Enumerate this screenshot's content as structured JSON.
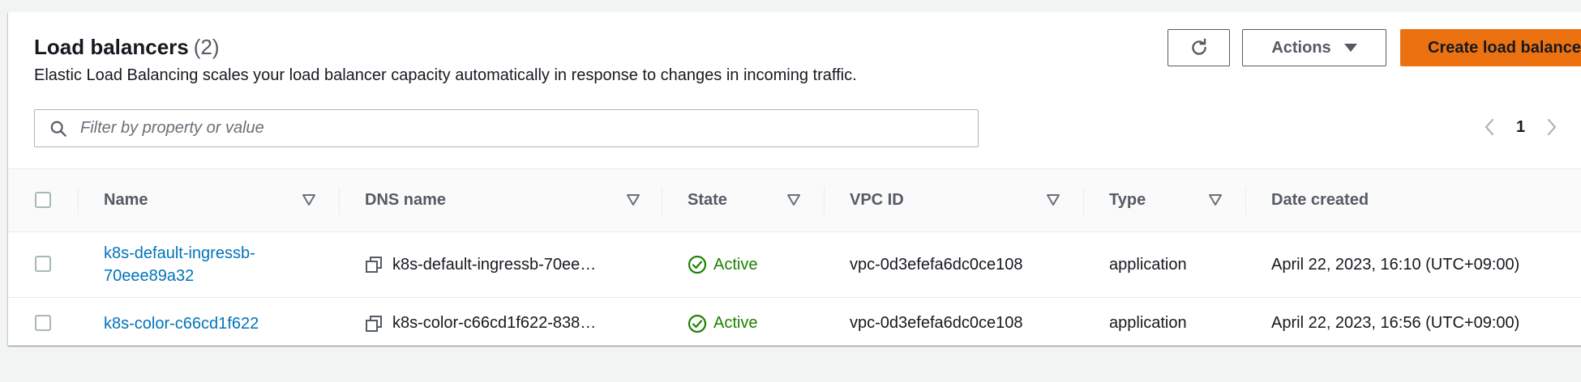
{
  "header": {
    "title": "Load balancers",
    "count": "(2)",
    "subtitle": "Elastic Load Balancing scales your load balancer capacity automatically in response to changes in incoming traffic."
  },
  "toolbar": {
    "refresh_icon": "refresh-icon",
    "actions_label": "Actions",
    "create_label": "Create load balancer"
  },
  "search": {
    "placeholder": "Filter by property or value",
    "value": ""
  },
  "pagination": {
    "current_page": "1"
  },
  "table": {
    "columns": [
      "Name",
      "DNS name",
      "State",
      "VPC ID",
      "Type",
      "Date created"
    ],
    "rows": [
      {
        "name": "k8s-default-ingressb-70eee89a32",
        "name_line1": "k8s-default-ingressb-",
        "name_line2": "70eee89a32",
        "dns": "k8s-default-ingressb-70ee…",
        "state": "Active",
        "vpc": "vpc-0d3efefa6dc0ce108",
        "type": "application",
        "date": "April 22, 2023, 16:10 (UTC+09:00)"
      },
      {
        "name": "k8s-color-c66cd1f622",
        "dns": "k8s-color-c66cd1f622-838…",
        "state": "Active",
        "vpc": "vpc-0d3efefa6dc0ce108",
        "type": "application",
        "date": "April 22, 2023, 16:56 (UTC+09:00)"
      }
    ]
  },
  "colors": {
    "primary": "#ec7211",
    "link": "#0073bb",
    "success": "#1d8102"
  }
}
